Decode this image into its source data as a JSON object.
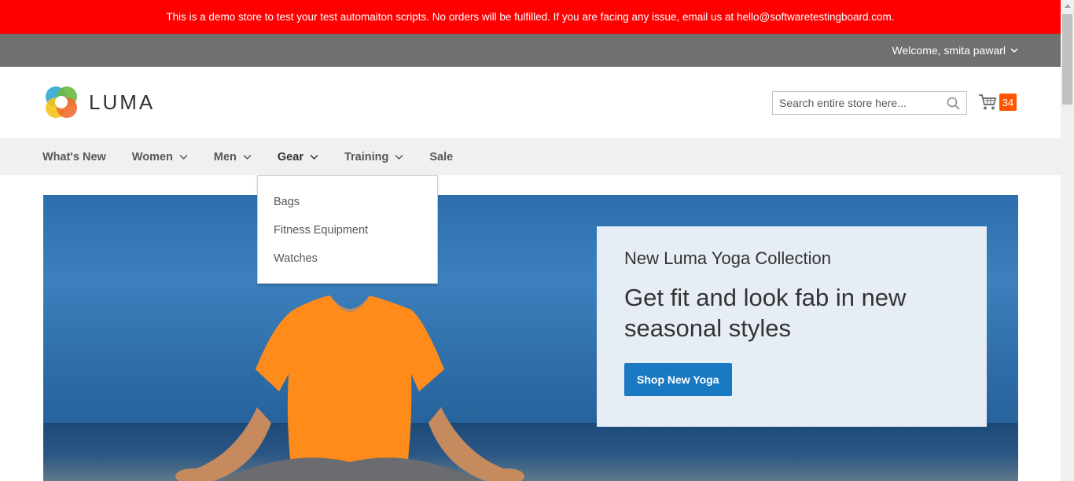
{
  "demo_notice": "This is a demo store to test your test automaiton scripts. No orders will be fulfilled. If you are facing any issue, email us at hello@softwaretestingboard.com.",
  "header": {
    "welcome": "Welcome, smita pawarl",
    "logo_text": "LUMA",
    "search": {
      "placeholder": "Search entire store here..."
    },
    "cart_count": "34"
  },
  "nav": {
    "items": [
      {
        "label": "What's New"
      },
      {
        "label": "Women"
      },
      {
        "label": "Men"
      },
      {
        "label": "Gear"
      },
      {
        "label": "Training"
      },
      {
        "label": "Sale"
      }
    ]
  },
  "gear_dropdown": {
    "items": [
      "Bags",
      "Fitness Equipment",
      "Watches"
    ]
  },
  "promo": {
    "subtitle": "New Luma Yoga Collection",
    "headline": "Get fit and look fab in new seasonal styles",
    "button": "Shop New Yoga"
  },
  "colors": {
    "demo_bar": "#ff0000",
    "panel_bar": "#6e716e",
    "nav_bg": "#f0f0f0",
    "cart_counter": "#ff5501",
    "primary_button": "#1979c3",
    "promo_bg": "#e6edf5"
  },
  "icons": {
    "search": "search-icon",
    "cart": "cart-icon",
    "chevron": "chevron-down-icon",
    "logo": "luma-logo-icon"
  }
}
